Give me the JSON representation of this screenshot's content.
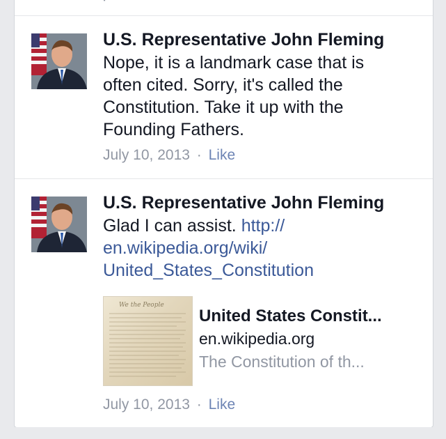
{
  "comments": [
    {
      "author": "U.S. Representative John Fleming",
      "text_lines": [
        "Nope, it is a landmark case that is",
        "often cited. Sorry, it's called the",
        "Constitution. Take it up with the",
        "Founding Fathers."
      ],
      "date": "July 10, 2013",
      "separator": "·",
      "like_label": "Like"
    },
    {
      "author": "U.S. Representative John Fleming",
      "text_prefix": "Glad I can assist. ",
      "link_lines": [
        "http://",
        "en.wikipedia.org/wiki/",
        "United_States_Constitution"
      ],
      "date": "July 10, 2013",
      "separator": "·",
      "like_label": "Like",
      "preview": {
        "title": "United States Constit...",
        "domain": "en.wikipedia.org",
        "description": "The Constitution of th..."
      }
    }
  ],
  "colors": {
    "link": "#3b5998",
    "meta": "#9197a3",
    "background": "#e9eaed"
  },
  "icons": [
    "avatar-photo",
    "constitution-document-thumbnail"
  ]
}
